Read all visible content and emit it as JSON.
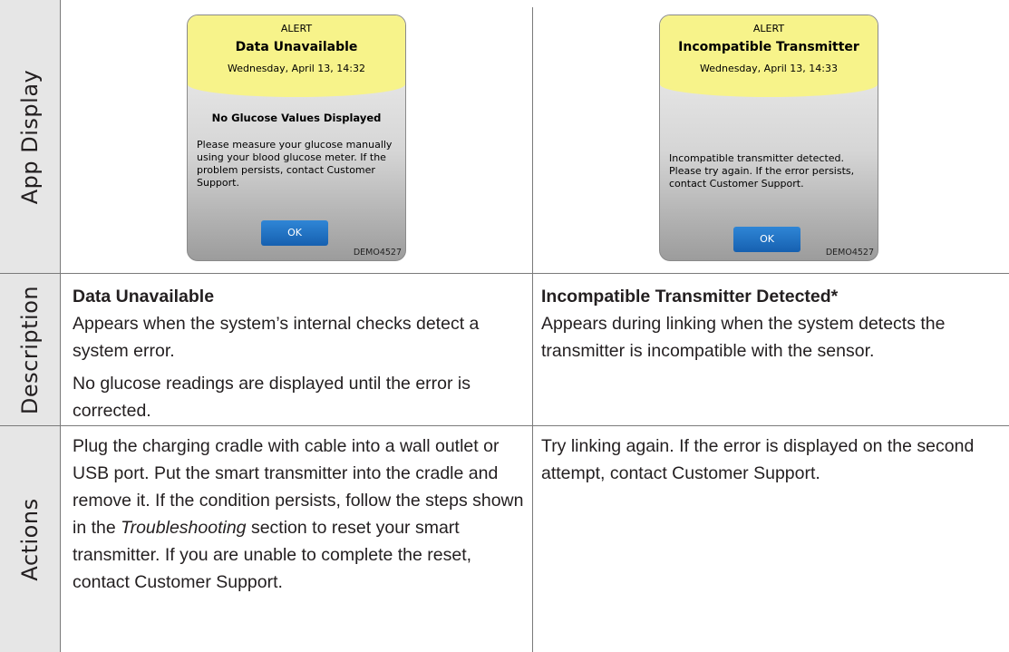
{
  "row_labels": {
    "app_display": "App Display",
    "description": "Description",
    "actions": "Actions"
  },
  "alerts": [
    {
      "kind": "ALERT",
      "title": "Data Unavailable",
      "time": "Wednesday, April 13, 14:32",
      "subtitle": "No Glucose Values Displayed",
      "message": "Please measure your glucose manually using your blood glucose meter. If the problem persists, contact Customer Support.",
      "button": "OK",
      "code": "DEMO4527"
    },
    {
      "kind": "ALERT",
      "title": "Incompatible Transmitter",
      "time": "Wednesday, April 13, 14:33",
      "subtitle": "",
      "message": "Incompatible transmitter detected. Please try again. If the error persists, contact Customer Support.",
      "button": "OK",
      "code": "DEMO4527"
    }
  ],
  "descriptions": [
    {
      "title": "Data Unavailable",
      "text": "Appears when the system’s internal checks detect a system error.",
      "text2": "No glucose readings are displayed until the error is corrected."
    },
    {
      "title": "Incompatible Transmitter Detected*",
      "text": "Appears during linking when the system detects the transmitter is incompatible with the sensor."
    }
  ],
  "actions": [
    {
      "before": "Plug the charging cradle with cable into a wall outlet or USB port. Put the smart transmitter into the cradle and remove it. If the condition persists, follow the steps shown in the ",
      "emph": "Troubleshooting",
      "after": " section to reset your smart transmitter. If you are unable to complete the reset, contact Customer Support."
    },
    {
      "text": "Try linking again. If the error is displayed on the second attempt, contact Customer Support."
    }
  ]
}
